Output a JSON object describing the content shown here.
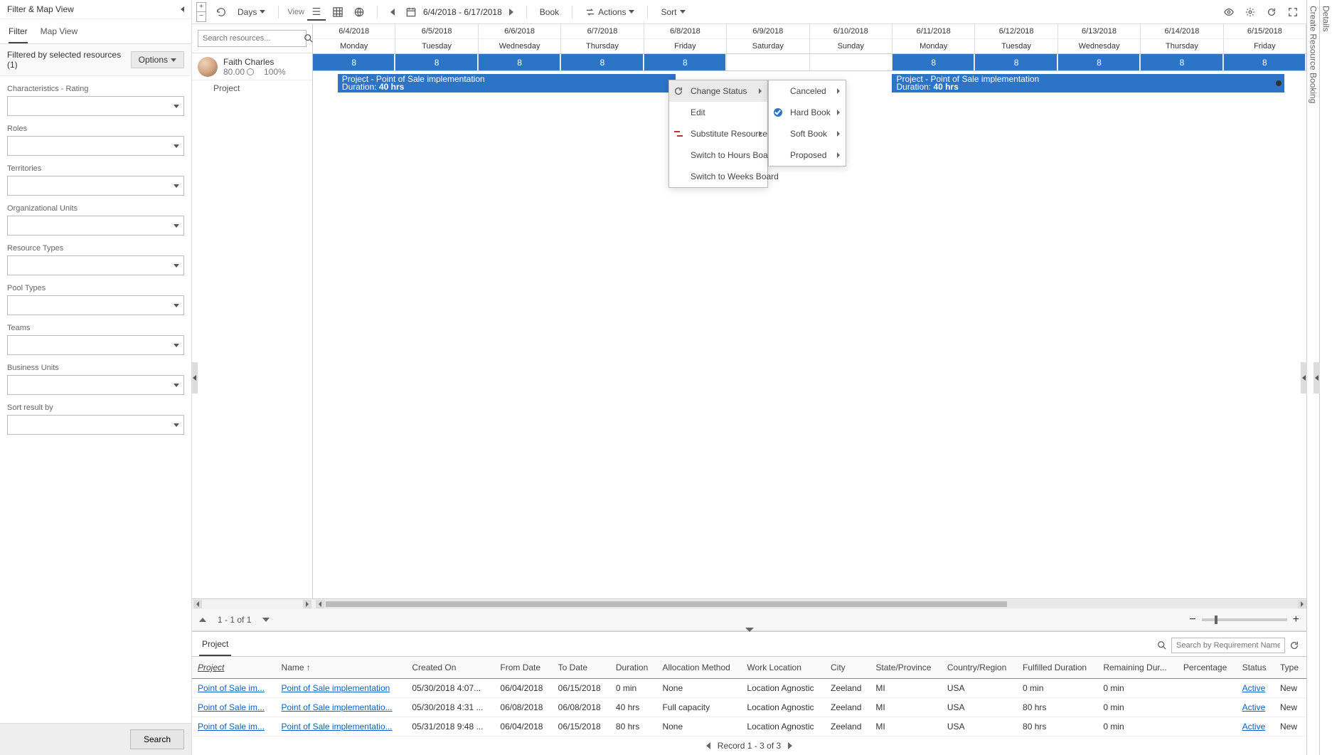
{
  "sidebar": {
    "title": "Filter & Map View",
    "tabs": [
      "Filter",
      "Map View"
    ],
    "filtered_text": "Filtered by selected resources (1)",
    "options_label": "Options",
    "search_btn": "Search",
    "groups": [
      "Characteristics - Rating",
      "Roles",
      "Territories",
      "Organizational Units",
      "Resource Types",
      "Pool Types",
      "Teams",
      "Business Units",
      "Sort result by"
    ]
  },
  "toolbar": {
    "days_label": "Days",
    "view_label": "View",
    "date_range": "6/4/2018 - 6/17/2018",
    "book_label": "Book",
    "actions_label": "Actions",
    "sort_label": "Sort"
  },
  "dates": [
    {
      "d": "6/4/2018",
      "w": "Monday"
    },
    {
      "d": "6/5/2018",
      "w": "Tuesday"
    },
    {
      "d": "6/6/2018",
      "w": "Wednesday"
    },
    {
      "d": "6/7/2018",
      "w": "Thursday"
    },
    {
      "d": "6/8/2018",
      "w": "Friday"
    },
    {
      "d": "6/9/2018",
      "w": "Saturday"
    },
    {
      "d": "6/10/2018",
      "w": "Sunday"
    },
    {
      "d": "6/11/2018",
      "w": "Monday"
    },
    {
      "d": "6/12/2018",
      "w": "Tuesday"
    },
    {
      "d": "6/13/2018",
      "w": "Wednesday"
    },
    {
      "d": "6/14/2018",
      "w": "Thursday"
    },
    {
      "d": "6/15/2018",
      "w": "Friday"
    }
  ],
  "alloc": [
    "8",
    "8",
    "8",
    "8",
    "8",
    "",
    "",
    "8",
    "8",
    "8",
    "8",
    "8"
  ],
  "resource": {
    "search_placeholder": "Search resources...",
    "name": "Faith Charles",
    "hours": "80.00",
    "util": "100%",
    "project_label": "Project"
  },
  "bookings": [
    {
      "title": "Project - Point of Sale implementation",
      "duration_label": "Duration:",
      "duration": "40 hrs",
      "left_pct": 2.5,
      "width_pct": 34,
      "dot": false
    },
    {
      "title": "Project - Point of Sale implementation",
      "duration_label": "Duration:",
      "duration": "40 hrs",
      "left_pct": 58.3,
      "width_pct": 39.5,
      "dot": true
    }
  ],
  "context_menu": {
    "items": [
      {
        "label": "Change Status",
        "icon": "sync",
        "sub": true,
        "hover": true
      },
      {
        "label": "Edit"
      },
      {
        "label": "Substitute Resource",
        "icon": "swap",
        "sub": true
      },
      {
        "label": "Switch to Hours Board"
      },
      {
        "label": "Switch to Weeks Board"
      }
    ],
    "status_items": [
      {
        "label": "Canceled",
        "sub": true
      },
      {
        "label": "Hard Book",
        "checked": true,
        "sub": true
      },
      {
        "label": "Soft Book",
        "sub": true
      },
      {
        "label": "Proposed",
        "sub": true
      }
    ]
  },
  "pager": {
    "text": "1 - 1 of 1"
  },
  "bottom": {
    "tab": "Project",
    "search_placeholder": "Search by Requirement Name",
    "columns": [
      "Project",
      "Name",
      "Created On",
      "From Date",
      "To Date",
      "Duration",
      "Allocation Method",
      "Work Location",
      "City",
      "State/Province",
      "Country/Region",
      "Fulfilled Duration",
      "Remaining Dur...",
      "Percentage",
      "Status",
      "Type"
    ],
    "rows": [
      {
        "project": "Point of Sale im...",
        "name": "Point of Sale implementation",
        "created": "05/30/2018 4:07...",
        "from": "06/04/2018",
        "to": "06/15/2018",
        "dur": "0 min",
        "alloc": "None",
        "workloc": "Location Agnostic",
        "city": "Zeeland",
        "state": "MI",
        "country": "USA",
        "fdur": "0 min",
        "rdur": "0 min",
        "pct": "",
        "status": "Active",
        "type": "New"
      },
      {
        "project": "Point of Sale im...",
        "name": "Point of Sale implementatio...",
        "created": "05/30/2018 4:31 ...",
        "from": "06/08/2018",
        "to": "06/08/2018",
        "dur": "40 hrs",
        "alloc": "Full capacity",
        "workloc": "Location Agnostic",
        "city": "Zeeland",
        "state": "MI",
        "country": "USA",
        "fdur": "80 hrs",
        "rdur": "0 min",
        "pct": "",
        "status": "Active",
        "type": "New"
      },
      {
        "project": "Point of Sale im...",
        "name": "Point of Sale implementatio...",
        "created": "05/31/2018 9:48 ...",
        "from": "06/04/2018",
        "to": "06/15/2018",
        "dur": "80 hrs",
        "alloc": "None",
        "workloc": "Location Agnostic",
        "city": "Zeeland",
        "state": "MI",
        "country": "USA",
        "fdur": "80 hrs",
        "rdur": "0 min",
        "pct": "",
        "status": "Active",
        "type": "New"
      }
    ],
    "record_text": "Record 1 - 3 of 3"
  },
  "right_rails": {
    "booking": "Create Resource Booking",
    "details": "Details"
  }
}
